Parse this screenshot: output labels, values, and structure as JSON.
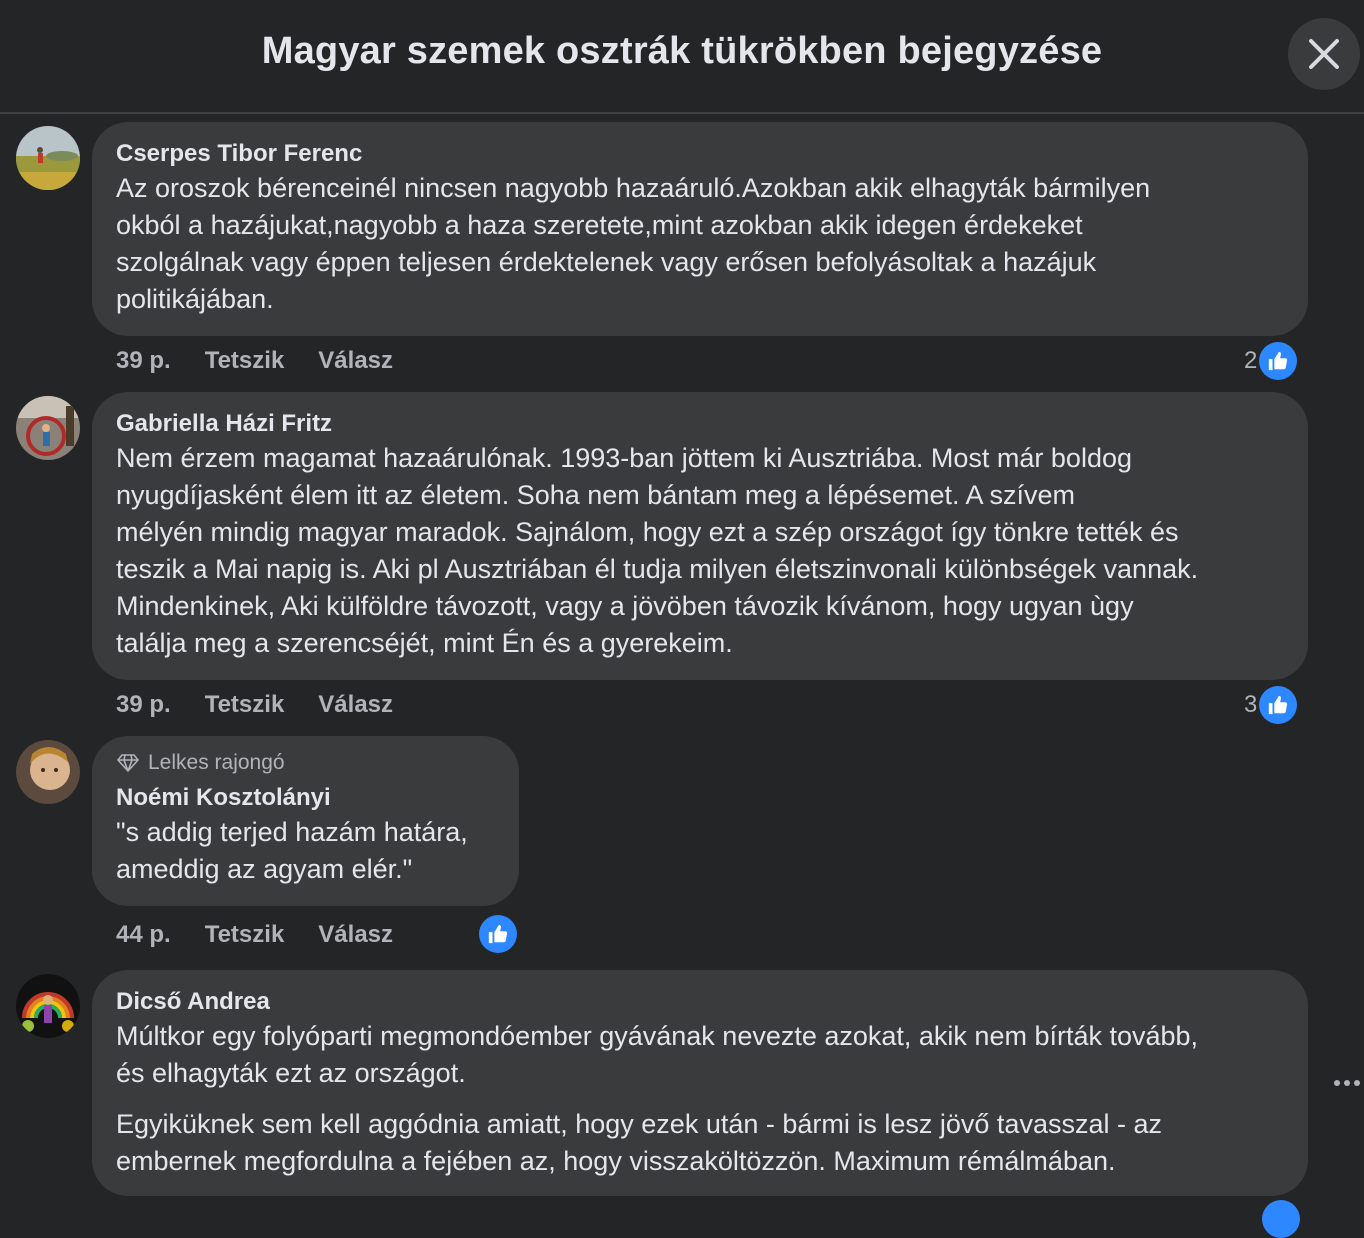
{
  "header": {
    "title": "Magyar szemek osztrák tükrökben bejegyzése"
  },
  "comments": [
    {
      "author": "Cserpes Tibor Ferenc",
      "text": "Az oroszok bérenceinél nincsen nagyobb hazaáruló.Azokban akik elhagyták bármilyen\nokból a hazájukat,nagyobb a haza szeretete,mint azokban akik idegen érdekeket\nszolgálnak vagy éppen teljesen érdektelenek vagy erősen befolyásoltak a hazájuk\npolitikájában.",
      "time": "39 p.",
      "like_label": "Tetszik",
      "reply_label": "Válasz",
      "reaction_count": "2"
    },
    {
      "author": "Gabriella Házi Fritz",
      "text": "Nem érzem magamat hazaárulónak. 1993-ban jöttem ki Ausztriába. Most már boldog\nnyugdíjasként élem itt az életem. Soha nem bántam meg a lépésemet. A szívem\nmélyén mindig magyar maradok. Sajnálom, hogy ezt a szép országot így tönkre tették és\nteszik a Mai napig is. Aki pl Ausztriában él tudja milyen életszinvonali különbségek vannak.\nMindenkinek, Aki külföldre távozott, vagy a jövöben távozik kívánom, hogy ugyan ùgy\ntalálja meg a szerencséjét, mint Én és a gyerekeim.",
      "time": "39 p.",
      "like_label": "Tetszik",
      "reply_label": "Válasz",
      "reaction_count": "3"
    },
    {
      "badge": "Lelkes rajongó",
      "author": "Noémi Kosztolányi",
      "text": "\"s addig terjed hazám határa,\nameddig az agyam elér.\"",
      "time": "44 p.",
      "like_label": "Tetszik",
      "reply_label": "Válasz"
    },
    {
      "author": "Dicső Andrea",
      "paragraphs": [
        "Múltkor egy folyóparti megmondóember gyávának nevezte azokat, akik nem bírták tovább,\nés elhagyták ezt az országot.",
        "Egyiküknek sem kell aggódnia amiatt, hogy ezek után - bármi is lesz jövő tavasszal - az\nembernek megfordulna a fejében az, hogy visszaköltözzön. Maximum rémálmában."
      ]
    }
  ],
  "colors": {
    "background": "#242526",
    "bubble": "#3a3b3c",
    "text": "#e4e6eb",
    "secondary_text": "#b0b3b8",
    "like_blue": "#2d88ff"
  },
  "icons": [
    "close-icon",
    "diamond-icon",
    "like-thumb-icon",
    "more-options-icon"
  ]
}
